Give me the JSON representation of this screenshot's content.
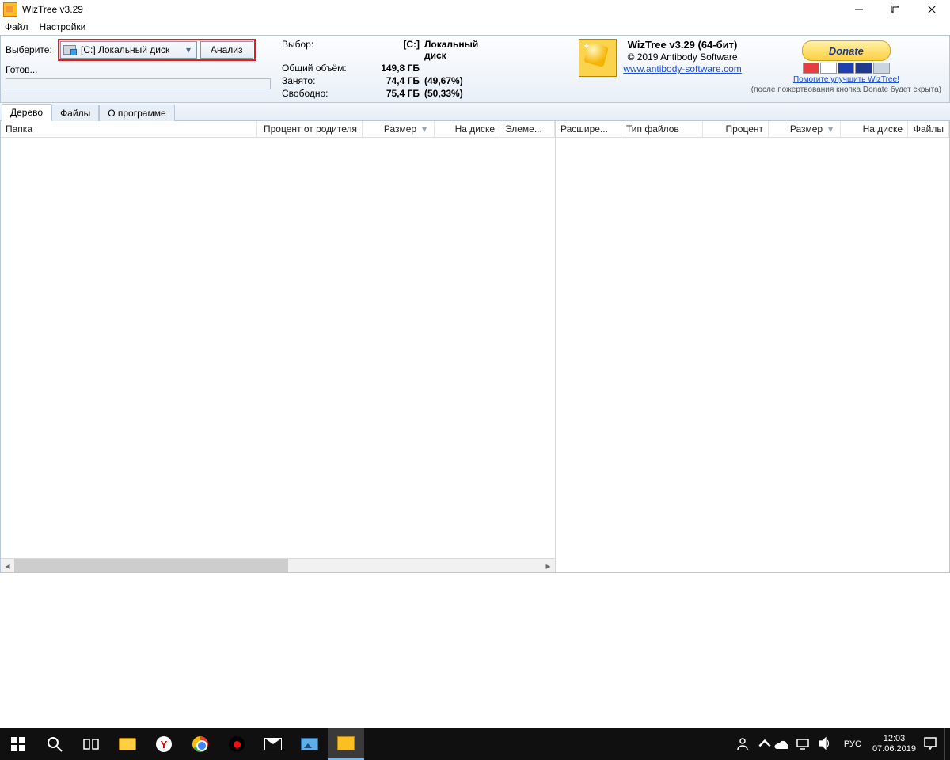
{
  "titlebar": {
    "title": "WizTree v3.29"
  },
  "menu": {
    "file": "Файл",
    "settings": "Настройки"
  },
  "toolbar": {
    "select_label": "Выберите:",
    "drive_text": "[C:] Локальный диск",
    "analyze": "Анализ",
    "status": "Готов..."
  },
  "info": {
    "selection_label": "Выбор:",
    "selection_drive": "[C:]",
    "selection_name": "Локальный диск",
    "total_label": "Общий объём:",
    "total_value": "149,8 ГБ",
    "used_label": "Занято:",
    "used_value": "74,4 ГБ",
    "used_pct": "(49,67%)",
    "free_label": "Свободно:",
    "free_value": "75,4 ГБ",
    "free_pct": "(50,33%)"
  },
  "brand": {
    "line1": "WizTree v3.29 (64-бит)",
    "line2": "© 2019 Antibody Software",
    "line3": "www.antibody-software.com",
    "donate": "Donate",
    "note": "Помогите улучшить WizTree!",
    "foot": "(после пожертвования кнопка Donate будет скрыта)"
  },
  "tabs": {
    "tree": "Дерево",
    "files": "Файлы",
    "about": "О программе"
  },
  "cols_left": {
    "folder": "Папка",
    "pct_parent": "Процент от родителя",
    "size": "Размер",
    "ondisk": "На диске",
    "elems": "Элеме..."
  },
  "cols_right": {
    "ext": "Расшире...",
    "type": "Тип файлов",
    "pct": "Процент",
    "size": "Размер",
    "ondisk": "На диске",
    "files": "Файлы"
  },
  "taskbar": {
    "lang": "РУС",
    "time": "12:03",
    "date": "07.06.2019"
  }
}
